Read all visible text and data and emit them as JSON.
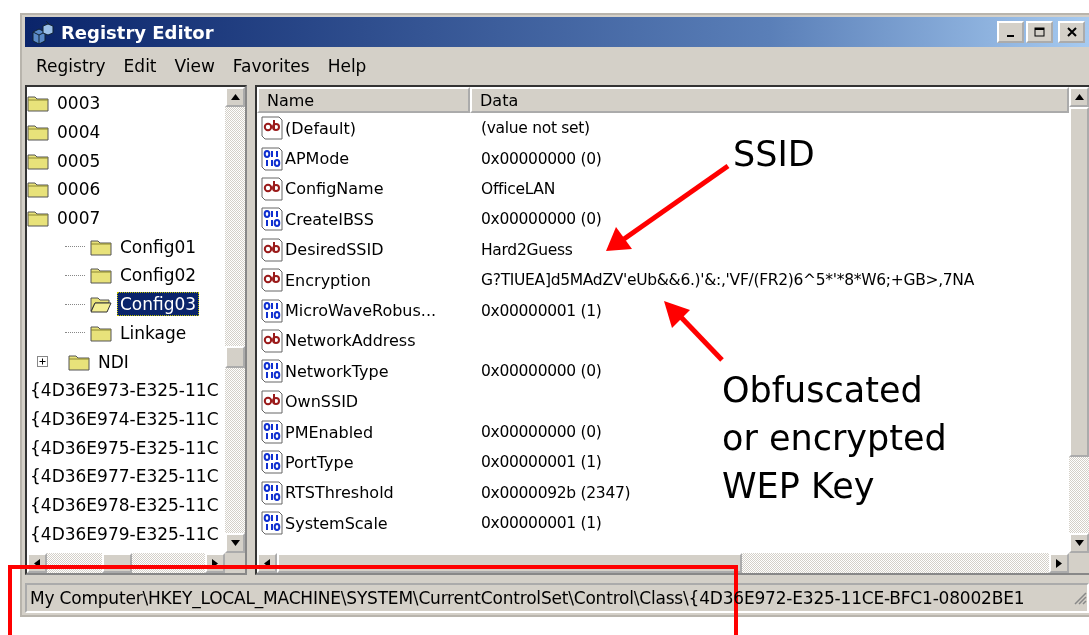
{
  "window": {
    "title": "Registry Editor"
  },
  "menu": [
    {
      "label": "Registry"
    },
    {
      "label": "Edit"
    },
    {
      "label": "View"
    },
    {
      "label": "Favorites"
    },
    {
      "label": "Help"
    }
  ],
  "tree": [
    {
      "label": "0003",
      "kind": "folder",
      "selected": false
    },
    {
      "label": "0004",
      "kind": "folder",
      "selected": false
    },
    {
      "label": "0005",
      "kind": "folder",
      "selected": false
    },
    {
      "label": "0006",
      "kind": "folder",
      "selected": false
    },
    {
      "label": "0007",
      "kind": "folder",
      "selected": false,
      "children": [
        {
          "label": "Config01",
          "kind": "folder",
          "selected": false,
          "expandable": false
        },
        {
          "label": "Config02",
          "kind": "folder",
          "selected": false,
          "expandable": false
        },
        {
          "label": "Config03",
          "kind": "folder",
          "selected": true,
          "expandable": false
        },
        {
          "label": "Linkage",
          "kind": "folder",
          "selected": false,
          "expandable": false
        },
        {
          "label": "NDI",
          "kind": "folder",
          "selected": false,
          "expandable": true
        }
      ]
    },
    {
      "label": "{4D36E973-E325-11C",
      "kind": "key",
      "selected": false
    },
    {
      "label": "{4D36E974-E325-11C",
      "kind": "key",
      "selected": false
    },
    {
      "label": "{4D36E975-E325-11C",
      "kind": "key",
      "selected": false
    },
    {
      "label": "{4D36E977-E325-11C",
      "kind": "key",
      "selected": false
    },
    {
      "label": "{4D36E978-E325-11C",
      "kind": "key",
      "selected": false
    },
    {
      "label": "{4D36E979-E325-11C",
      "kind": "key",
      "selected": false
    }
  ],
  "table": {
    "columns": [
      "Name",
      "Data"
    ],
    "rows": [
      {
        "kind": "string",
        "name": "(Default)",
        "data": "(value not set)"
      },
      {
        "kind": "dword",
        "name": "APMode",
        "data": "0x00000000 (0)"
      },
      {
        "kind": "string",
        "name": "ConfigName",
        "data": "OfficeLAN"
      },
      {
        "kind": "dword",
        "name": "CreateIBSS",
        "data": "0x00000000 (0)"
      },
      {
        "kind": "string",
        "name": "DesiredSSID",
        "data": "Hard2Guess"
      },
      {
        "kind": "string",
        "name": "Encryption",
        "data": "G?TIUEA]d5MAdZV'eUb&&6.)'&:,'VF/(FR2)6^5*'*8*W6;+GB>,7NA"
      },
      {
        "kind": "dword",
        "name": "MicroWaveRobus...",
        "data": "0x00000001 (1)"
      },
      {
        "kind": "string",
        "name": "NetworkAddress"
      },
      {
        "kind": "dword",
        "name": "NetworkType",
        "data": "0x00000000 (0)"
      },
      {
        "kind": "string",
        "name": "OwnSSID"
      },
      {
        "kind": "dword",
        "name": "PMEnabled",
        "data": "0x00000000 (0)"
      },
      {
        "kind": "dword",
        "name": "PortType",
        "data": "0x00000001 (1)"
      },
      {
        "kind": "dword",
        "name": "RTSThreshold",
        "data": "0x0000092b (2347)"
      },
      {
        "kind": "dword",
        "name": "SystemScale",
        "data": "0x00000001 (1)"
      }
    ]
  },
  "status_bar": "My Computer\\HKEY_LOCAL_MACHINE\\SYSTEM\\CurrentControlSet\\Control\\Class\\{4D36E972-E325-11CE-BFC1-08002BE1",
  "annotations": [
    {
      "text": "SSID"
    },
    {
      "text": "Obfuscated\nor encrypted\nWEP Key"
    }
  ]
}
